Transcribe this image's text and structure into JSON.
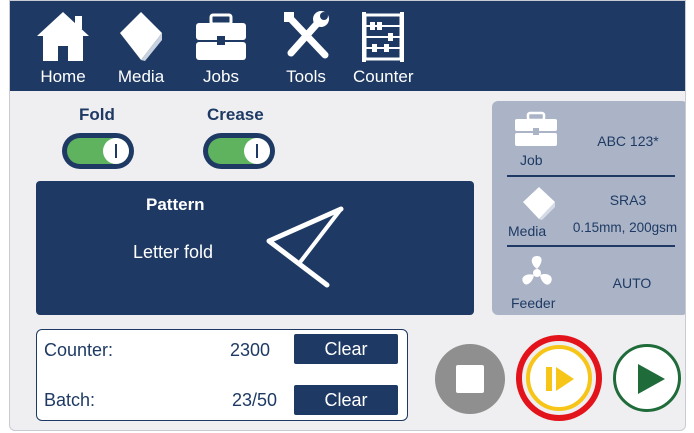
{
  "nav": {
    "home": "Home",
    "media": "Media",
    "jobs": "Jobs",
    "tools": "Tools",
    "counter": "Counter"
  },
  "toggles": {
    "fold": {
      "label": "Fold",
      "state": "on"
    },
    "crease": {
      "label": "Crease",
      "state": "on"
    }
  },
  "pattern": {
    "title": "Pattern",
    "value": "Letter fold",
    "icon": "letter-fold-icon"
  },
  "info_panel": {
    "job": {
      "label": "Job",
      "value": "ABC 123*",
      "icon": "briefcase-icon"
    },
    "media": {
      "label": "Media",
      "value_line1": "SRA3",
      "value_line2": "0.15mm, 200gsm",
      "icon": "media-sheet-icon"
    },
    "feeder": {
      "label": "Feeder",
      "value": "AUTO",
      "icon": "fan-icon"
    }
  },
  "counters": {
    "counter": {
      "label": "Counter:",
      "value": "2300",
      "clear_label": "Clear"
    },
    "batch": {
      "label": "Batch:",
      "value": "23/50",
      "clear_label": "Clear"
    }
  },
  "controls": {
    "stop": {
      "icon": "stop-icon"
    },
    "step": {
      "icon": "step-run-icon",
      "highlighted": true
    },
    "start": {
      "icon": "play-icon"
    }
  },
  "colors": {
    "navy": "#1e3a64",
    "panel_bg": "#efeff1",
    "info_bg": "#abb4c6",
    "toggle_green": "#5fb35f",
    "highlight_red": "#e3131b",
    "step_yellow": "#f7c518",
    "play_green": "#1f6b3a",
    "stop_gray": "#8f8f8f"
  }
}
